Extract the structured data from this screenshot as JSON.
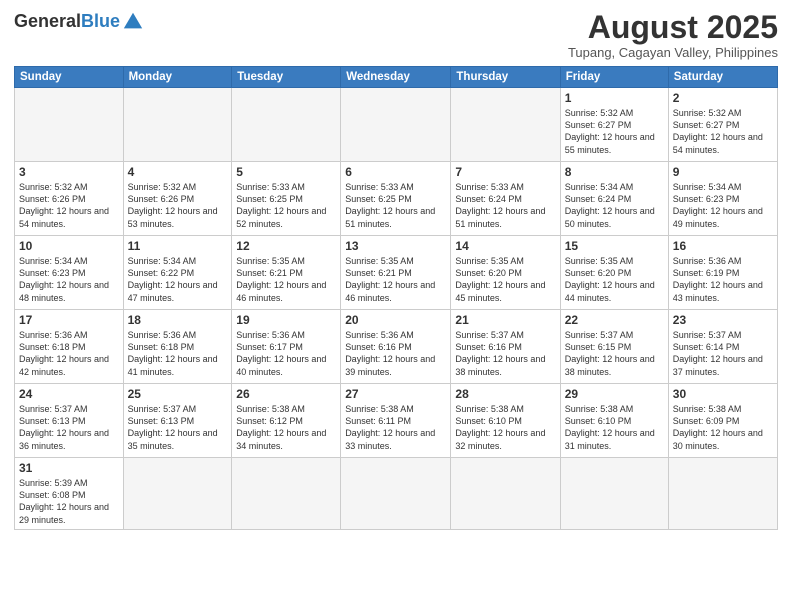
{
  "logo": {
    "general": "General",
    "blue": "Blue"
  },
  "title": "August 2025",
  "subtitle": "Tupang, Cagayan Valley, Philippines",
  "days_of_week": [
    "Sunday",
    "Monday",
    "Tuesday",
    "Wednesday",
    "Thursday",
    "Friday",
    "Saturday"
  ],
  "weeks": [
    [
      {
        "day": "",
        "info": ""
      },
      {
        "day": "",
        "info": ""
      },
      {
        "day": "",
        "info": ""
      },
      {
        "day": "",
        "info": ""
      },
      {
        "day": "",
        "info": ""
      },
      {
        "day": "1",
        "info": "Sunrise: 5:32 AM\nSunset: 6:27 PM\nDaylight: 12 hours\nand 55 minutes."
      },
      {
        "day": "2",
        "info": "Sunrise: 5:32 AM\nSunset: 6:27 PM\nDaylight: 12 hours\nand 54 minutes."
      }
    ],
    [
      {
        "day": "3",
        "info": "Sunrise: 5:32 AM\nSunset: 6:26 PM\nDaylight: 12 hours\nand 54 minutes."
      },
      {
        "day": "4",
        "info": "Sunrise: 5:32 AM\nSunset: 6:26 PM\nDaylight: 12 hours\nand 53 minutes."
      },
      {
        "day": "5",
        "info": "Sunrise: 5:33 AM\nSunset: 6:25 PM\nDaylight: 12 hours\nand 52 minutes."
      },
      {
        "day": "6",
        "info": "Sunrise: 5:33 AM\nSunset: 6:25 PM\nDaylight: 12 hours\nand 51 minutes."
      },
      {
        "day": "7",
        "info": "Sunrise: 5:33 AM\nSunset: 6:24 PM\nDaylight: 12 hours\nand 51 minutes."
      },
      {
        "day": "8",
        "info": "Sunrise: 5:34 AM\nSunset: 6:24 PM\nDaylight: 12 hours\nand 50 minutes."
      },
      {
        "day": "9",
        "info": "Sunrise: 5:34 AM\nSunset: 6:23 PM\nDaylight: 12 hours\nand 49 minutes."
      }
    ],
    [
      {
        "day": "10",
        "info": "Sunrise: 5:34 AM\nSunset: 6:23 PM\nDaylight: 12 hours\nand 48 minutes."
      },
      {
        "day": "11",
        "info": "Sunrise: 5:34 AM\nSunset: 6:22 PM\nDaylight: 12 hours\nand 47 minutes."
      },
      {
        "day": "12",
        "info": "Sunrise: 5:35 AM\nSunset: 6:21 PM\nDaylight: 12 hours\nand 46 minutes."
      },
      {
        "day": "13",
        "info": "Sunrise: 5:35 AM\nSunset: 6:21 PM\nDaylight: 12 hours\nand 46 minutes."
      },
      {
        "day": "14",
        "info": "Sunrise: 5:35 AM\nSunset: 6:20 PM\nDaylight: 12 hours\nand 45 minutes."
      },
      {
        "day": "15",
        "info": "Sunrise: 5:35 AM\nSunset: 6:20 PM\nDaylight: 12 hours\nand 44 minutes."
      },
      {
        "day": "16",
        "info": "Sunrise: 5:36 AM\nSunset: 6:19 PM\nDaylight: 12 hours\nand 43 minutes."
      }
    ],
    [
      {
        "day": "17",
        "info": "Sunrise: 5:36 AM\nSunset: 6:18 PM\nDaylight: 12 hours\nand 42 minutes."
      },
      {
        "day": "18",
        "info": "Sunrise: 5:36 AM\nSunset: 6:18 PM\nDaylight: 12 hours\nand 41 minutes."
      },
      {
        "day": "19",
        "info": "Sunrise: 5:36 AM\nSunset: 6:17 PM\nDaylight: 12 hours\nand 40 minutes."
      },
      {
        "day": "20",
        "info": "Sunrise: 5:36 AM\nSunset: 6:16 PM\nDaylight: 12 hours\nand 39 minutes."
      },
      {
        "day": "21",
        "info": "Sunrise: 5:37 AM\nSunset: 6:16 PM\nDaylight: 12 hours\nand 38 minutes."
      },
      {
        "day": "22",
        "info": "Sunrise: 5:37 AM\nSunset: 6:15 PM\nDaylight: 12 hours\nand 38 minutes."
      },
      {
        "day": "23",
        "info": "Sunrise: 5:37 AM\nSunset: 6:14 PM\nDaylight: 12 hours\nand 37 minutes."
      }
    ],
    [
      {
        "day": "24",
        "info": "Sunrise: 5:37 AM\nSunset: 6:13 PM\nDaylight: 12 hours\nand 36 minutes."
      },
      {
        "day": "25",
        "info": "Sunrise: 5:37 AM\nSunset: 6:13 PM\nDaylight: 12 hours\nand 35 minutes."
      },
      {
        "day": "26",
        "info": "Sunrise: 5:38 AM\nSunset: 6:12 PM\nDaylight: 12 hours\nand 34 minutes."
      },
      {
        "day": "27",
        "info": "Sunrise: 5:38 AM\nSunset: 6:11 PM\nDaylight: 12 hours\nand 33 minutes."
      },
      {
        "day": "28",
        "info": "Sunrise: 5:38 AM\nSunset: 6:10 PM\nDaylight: 12 hours\nand 32 minutes."
      },
      {
        "day": "29",
        "info": "Sunrise: 5:38 AM\nSunset: 6:10 PM\nDaylight: 12 hours\nand 31 minutes."
      },
      {
        "day": "30",
        "info": "Sunrise: 5:38 AM\nSunset: 6:09 PM\nDaylight: 12 hours\nand 30 minutes."
      }
    ],
    [
      {
        "day": "31",
        "info": "Sunrise: 5:39 AM\nSunset: 6:08 PM\nDaylight: 12 hours\nand 29 minutes."
      },
      {
        "day": "",
        "info": ""
      },
      {
        "day": "",
        "info": ""
      },
      {
        "day": "",
        "info": ""
      },
      {
        "day": "",
        "info": ""
      },
      {
        "day": "",
        "info": ""
      },
      {
        "day": "",
        "info": ""
      }
    ]
  ]
}
